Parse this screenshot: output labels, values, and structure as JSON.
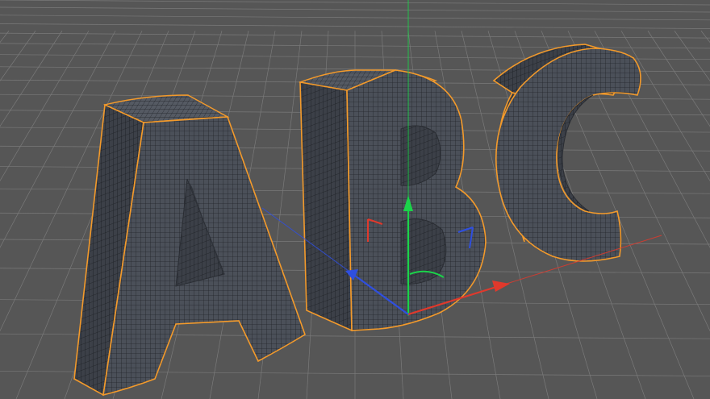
{
  "viewport": {
    "view": "3d-perspective-viewport",
    "background_color": "#565656",
    "grid_color": "#7a7a7a",
    "grid_visible": true
  },
  "scene_objects": [
    {
      "id": "text-A",
      "glyph": "A",
      "selected": true
    },
    {
      "id": "text-B",
      "glyph": "B",
      "selected": true
    },
    {
      "id": "text-C",
      "glyph": "C",
      "selected": true
    }
  ],
  "colors": {
    "mesh_face": "#4b5059",
    "mesh_side": "#3b3f47",
    "wireframe": "#1d1f24",
    "selection_outline": "#f39a2b",
    "axis_x": "#e0392c",
    "axis_y": "#1bd34a",
    "axis_z": "#2f4fe0"
  },
  "gizmo": {
    "type": "move-gizmo",
    "axes": [
      {
        "axis": "x",
        "icon": "x-axis-arrow-icon"
      },
      {
        "axis": "y",
        "icon": "y-axis-arrow-icon"
      },
      {
        "axis": "z",
        "icon": "z-axis-arrow-icon"
      }
    ],
    "plane_handles": [
      "xy-plane-handle-icon",
      "yz-plane-handle-icon",
      "xz-plane-handle-icon"
    ]
  }
}
